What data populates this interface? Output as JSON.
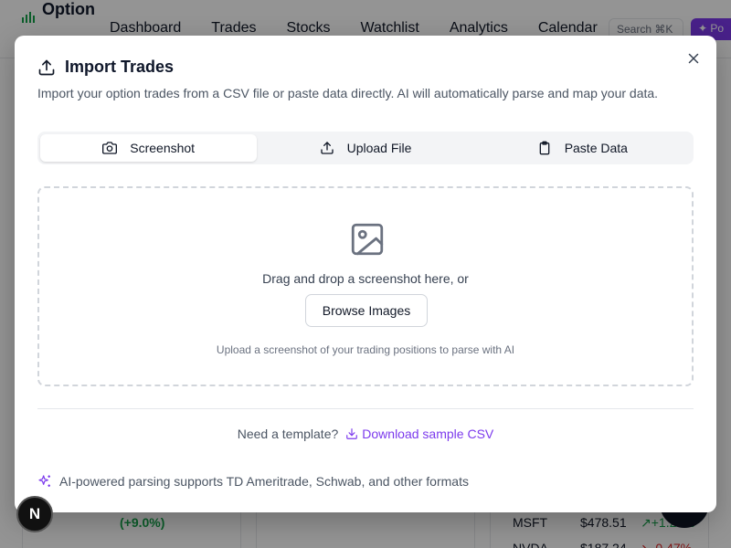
{
  "app": {
    "logo_text": "Option",
    "nav": [
      "Dashboard",
      "Trades",
      "Stocks",
      "Watchlist",
      "Analytics",
      "Calendar"
    ],
    "search_label": "Search ⌘K",
    "pro_label": "Po"
  },
  "background": {
    "percent_change": "(+9.0%)",
    "rows": [
      {
        "symbol": "MSFT",
        "price": "$478.51",
        "change": "+1.20%"
      },
      {
        "symbol": "NVDA",
        "price": "$187.24",
        "change": "-0.47%"
      }
    ],
    "badge": "N"
  },
  "modal": {
    "title": "Import Trades",
    "description": "Import your option trades from a CSV file or paste data directly. AI will automatically parse and map your data.",
    "tabs": [
      {
        "label": "Screenshot",
        "icon": "camera-icon",
        "active": true
      },
      {
        "label": "Upload File",
        "icon": "upload-icon",
        "active": false
      },
      {
        "label": "Paste Data",
        "icon": "clipboard-icon",
        "active": false
      }
    ],
    "dropzone": {
      "text": "Drag and drop a screenshot here, or",
      "button": "Browse Images",
      "hint": "Upload a screenshot of your trading positions to parse with AI"
    },
    "template_prompt": "Need a template?",
    "download_link": "Download sample CSV",
    "ai_note": "AI-powered parsing supports TD Ameritrade, Schwab, and other formats"
  },
  "colors": {
    "accent": "#7c3aed",
    "positive": "#16a34a",
    "negative": "#dc2626"
  }
}
